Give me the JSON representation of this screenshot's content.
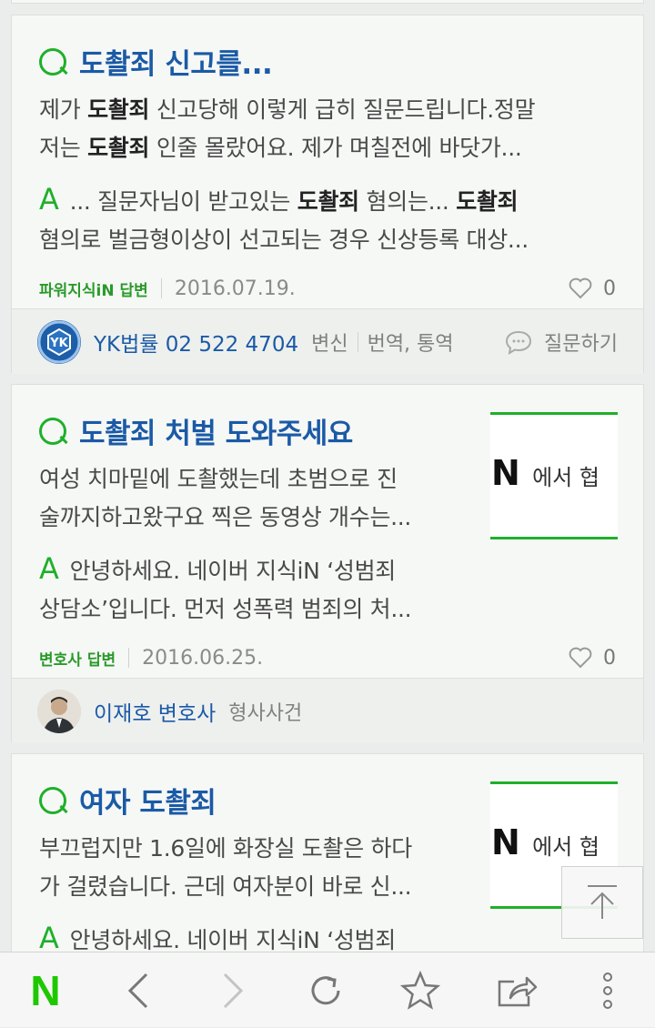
{
  "cards": [
    {
      "title": "도촬죄 신고를...",
      "q_lines": [
        [
          "제가 ",
          "도촬죄",
          " 신고당해 이렇게 급히 질문드립니다.정말"
        ],
        [
          "저는 ",
          "도촬죄",
          " 인줄 몰랐어요. 제가 며칠전에 바닷가..."
        ]
      ],
      "a_line1": [
        "... 질문자님이 받고있는 ",
        "도촬죄",
        " 혐의는... ",
        "도촬죄"
      ],
      "a_line2": "혐의로 벌금형이상이 선고되는 경우 신상등록 대상...",
      "badge": "파워지식iN 답변",
      "date": "2016.07.19.",
      "likes": "0",
      "footer_name": "YK법률 02 522 4704",
      "footer_cat1": "변신",
      "footer_cat2": "번역, 통역",
      "ask_label": "질문하기"
    },
    {
      "title": "도촬죄 처벌 도와주세요",
      "q_line1": "여성 치마밑에 도촬했는데 초범으로 진",
      "q_line2": "술까지하고왔구요 찍은 동영상 개수는...",
      "a_line1": "안녕하세요. 네이버 지식iN ‘성범죄",
      "a_line2": "상담소’입니다. 먼저 성폭력 범죄의 처...",
      "badge": "변호사 답변",
      "date": "2016.06.25.",
      "likes": "0",
      "thumb_main": "iN",
      "thumb_sub": "에서 협",
      "footer_name": "이재호 변호사",
      "footer_cat": "형사사건"
    },
    {
      "title": "여자 도촬죄",
      "q_line1": "부끄럽지만 1.6일에 화장실 도촬은 하다",
      "q_line2": "가 걸렸습니다. 근데 여자분이 바로 신...",
      "a_line1": "안녕하세요. 네이버 지식iN ‘성범죄",
      "thumb_main": "iN",
      "thumb_sub": "에서 협"
    }
  ],
  "toolbar": {
    "logo": "N",
    "items": [
      "naver-home",
      "back",
      "forward",
      "refresh",
      "bookmark",
      "share",
      "more"
    ]
  },
  "colors": {
    "accent_green": "#1fb02a",
    "link_blue": "#1b5aa6"
  }
}
